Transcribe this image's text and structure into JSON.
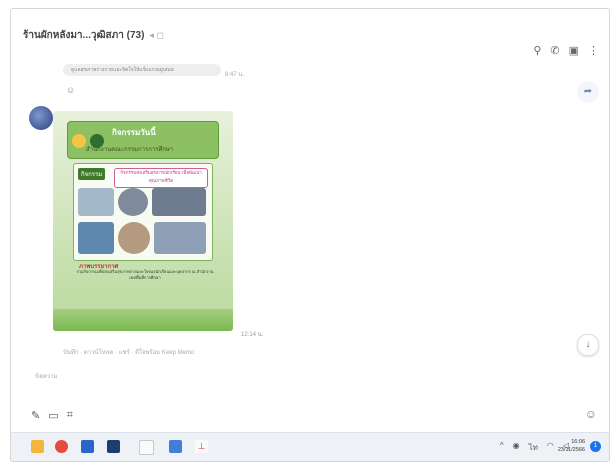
{
  "header": {
    "chat_name": "ร้านผักหลังมา...วุฒิสภา",
    "member_count": "(73)",
    "icons": [
      "search-icon",
      "phone-icon",
      "notes-icon",
      "more-icon"
    ]
  },
  "messages": {
    "prev_bubble_text": "ดูแลสุขภาพร่างกายและจิตใจให้แข็งแรงอยู่เสมอ",
    "prev_time": "8:47 น.",
    "poster_time": "12:14 น.",
    "poster_caption": "บันทึก · ดาวน์โหลด · แชร์ · ดีใจพร้อม Keep Memo",
    "poster": {
      "title": "กิจกรรมวันนี้",
      "subtitle": "สำนักงานคณะกรรมการการศึกษา",
      "tag_left": "กิจกรรม",
      "tag_right": "กิจกรรมส่งเสริมสุขภาพนักเรียน เพื่อพัฒนาคุณภาพชีวิต",
      "section_heading": "ภาพบรรยากาศ",
      "body_text": "ร่วมกิจกรรมเพื่อส่งเสริมสุขภาพกายและใจของนักเรียนและบุคลากร ณ สำนักงานเขตพื้นที่การศึกษา"
    }
  },
  "composer": {
    "placeholder": "ข้อความ"
  },
  "taskbar": {
    "time": "16:06",
    "date": "23/11/2566",
    "notification_count": "1"
  },
  "colors": {
    "accent": "#1a73e8",
    "poster_green": "#8cc063"
  }
}
